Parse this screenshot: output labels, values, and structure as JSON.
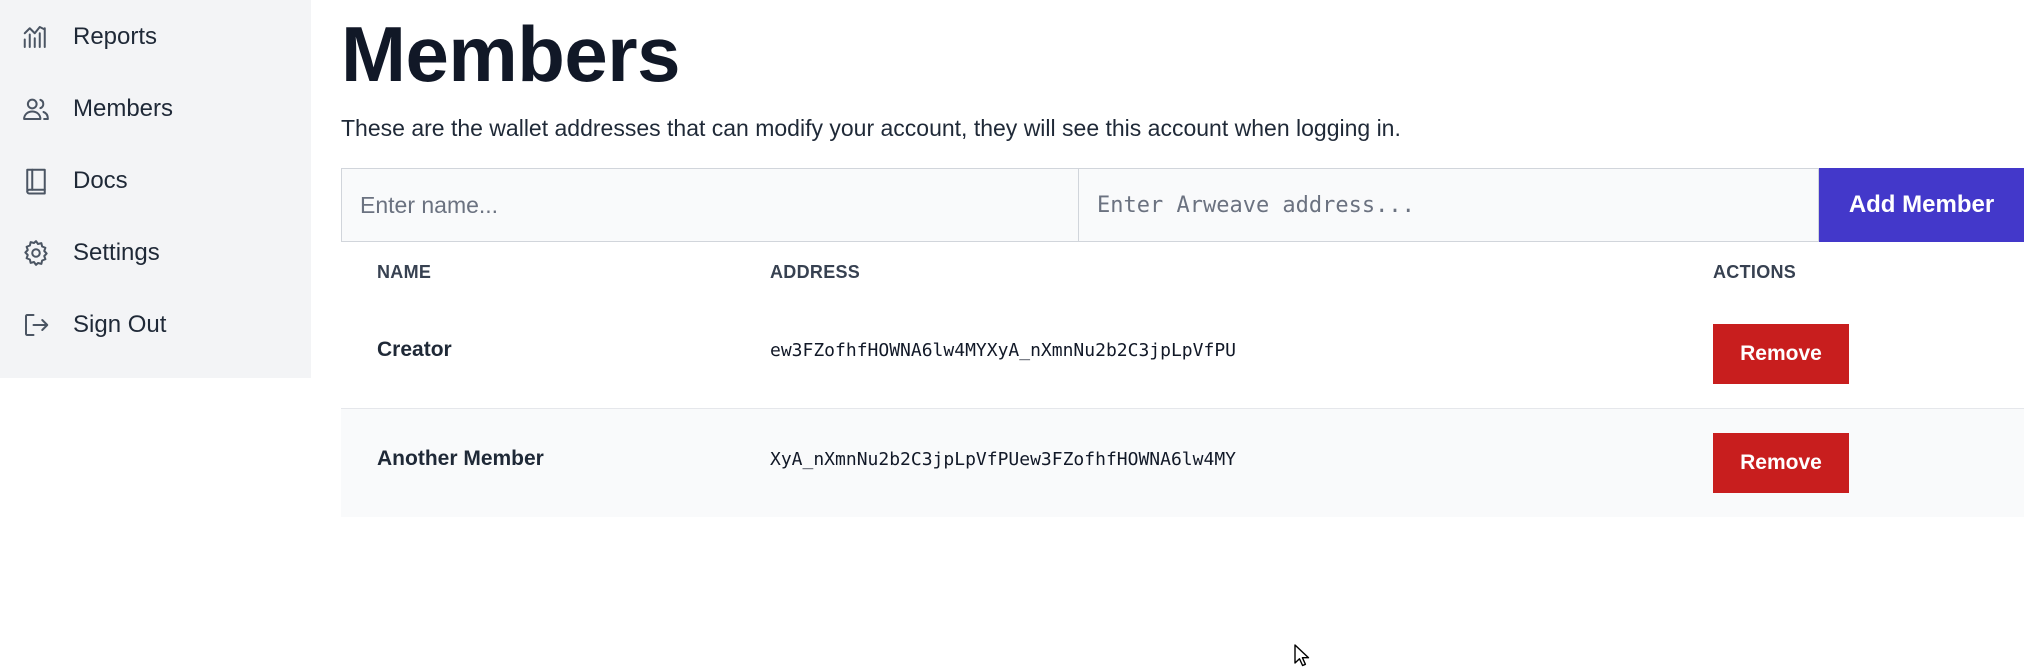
{
  "sidebar": {
    "items": [
      {
        "label": "Reports",
        "icon": "chart-line-icon"
      },
      {
        "label": "Members",
        "icon": "users-icon"
      },
      {
        "label": "Docs",
        "icon": "book-icon"
      },
      {
        "label": "Settings",
        "icon": "gear-icon"
      },
      {
        "label": "Sign Out",
        "icon": "sign-out-icon"
      }
    ]
  },
  "page": {
    "title": "Members",
    "subtitle": "These are the wallet addresses that can modify your account, they will see this account when logging in."
  },
  "form": {
    "name_placeholder": "Enter name...",
    "address_placeholder": "Enter Arweave address...",
    "add_label": "Add Member"
  },
  "table": {
    "headers": {
      "name": "NAME",
      "address": "ADDRESS",
      "actions": "ACTIONS"
    },
    "rows": [
      {
        "name": "Creator",
        "address": "ew3FZofhfHOWNA6lw4MYXyA_nXmnNu2b2C3jpLpVfPU",
        "action": "Remove"
      },
      {
        "name": "Another Member",
        "address": "XyA_nXmnNu2b2C3jpLpVfPUew3FZofhfHOWNA6lw4MY",
        "action": "Remove"
      }
    ]
  },
  "colors": {
    "sidebar_bg": "#f3f4f6",
    "accent": "#4338ca",
    "danger": "#c81e1e",
    "row_alt_bg": "#f9fafb"
  }
}
